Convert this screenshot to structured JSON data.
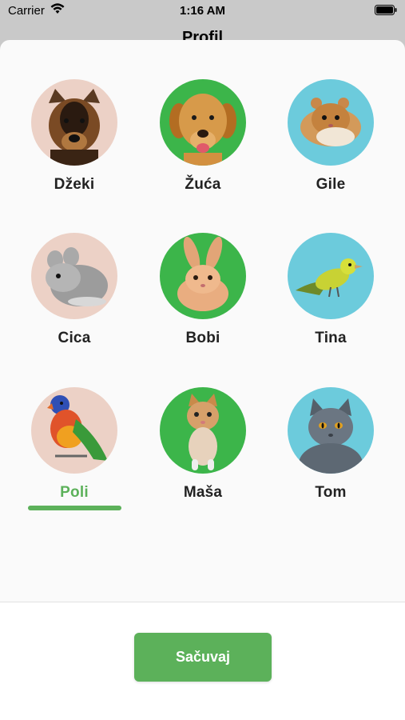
{
  "status": {
    "carrier": "Carrier",
    "time": "1:16 AM"
  },
  "header": {
    "title": "Profil"
  },
  "colors": {
    "accent": "#5cb15a",
    "pink": "#ecd1c6",
    "green": "#3cb54a",
    "blue": "#6ccbdc"
  },
  "pets": [
    {
      "name": "Džeki",
      "bg": "pink",
      "icon": "german-shepherd-icon"
    },
    {
      "name": "Žuća",
      "bg": "green",
      "icon": "golden-retriever-icon"
    },
    {
      "name": "Gile",
      "bg": "blue",
      "icon": "hamster-icon"
    },
    {
      "name": "Cica",
      "bg": "pink",
      "icon": "chinchilla-icon"
    },
    {
      "name": "Bobi",
      "bg": "green",
      "icon": "rabbit-icon"
    },
    {
      "name": "Tina",
      "bg": "blue",
      "icon": "canary-icon"
    },
    {
      "name": "Poli",
      "bg": "pink",
      "icon": "parrot-icon",
      "selected": true
    },
    {
      "name": "Maša",
      "bg": "green",
      "icon": "kitten-icon"
    },
    {
      "name": "Tom",
      "bg": "blue",
      "icon": "gray-cat-icon"
    }
  ],
  "footer": {
    "save_label": "Sačuvaj"
  }
}
